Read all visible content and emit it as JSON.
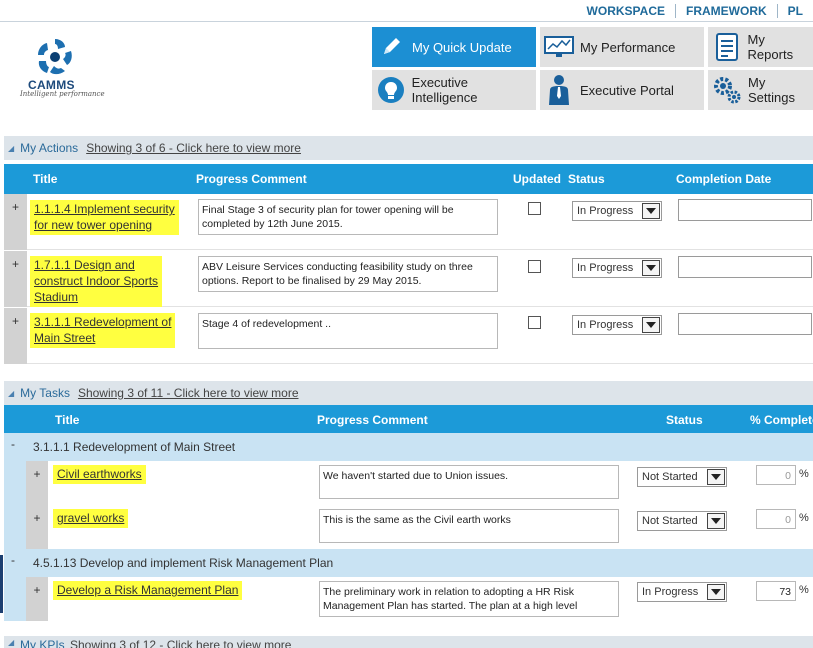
{
  "topnav": {
    "workspace": "WORKSPACE",
    "framework": "FRAMEWORK",
    "pl": "PL"
  },
  "logo": {
    "brand": "CAMMS",
    "tagline": "Intelligent performance"
  },
  "quick": {
    "update": "My Quick Update",
    "performance": "My Performance",
    "reports": "My Reports",
    "intelligence": "Executive Intelligence",
    "portal": "Executive Portal",
    "settings": "My Settings"
  },
  "actions": {
    "title": "My Actions",
    "more": "Showing 3 of 6 - Click here to view more",
    "headers": {
      "title": "Title",
      "comment": "Progress Comment",
      "updated": "Updated",
      "status": "Status",
      "date": "Completion Date"
    },
    "rows": [
      {
        "plus": "+",
        "title1": "1.1.1.4 Implement security",
        "title2": "for new tower opening",
        "title3": "",
        "comment1": "Final Stage 3 of security plan for tower opening will be",
        "comment2": "completed by 12th June 2015.",
        "status": "In Progress"
      },
      {
        "plus": "+",
        "title1": "1.7.1.1 Design and",
        "title2": "construct Indoor Sports",
        "title3": "Stadium",
        "comment1": "ABV Leisure Services conducting feasibility study on three",
        "comment2": "options. Report to be finalised by 29 May 2015.",
        "status": "In Progress"
      },
      {
        "plus": "+",
        "title1": "3.1.1.1 Redevelopment of",
        "title2": "Main Street",
        "title3": "",
        "comment1": "Stage 4 of redevelopment ..",
        "comment2": "",
        "status": "In Progress"
      }
    ]
  },
  "tasks": {
    "title": "My Tasks",
    "more": "Showing 3 of 11 - Click here to view more",
    "headers": {
      "title": "Title",
      "comment": "Progress Comment",
      "status": "Status",
      "complete": "% Complete"
    },
    "groups": [
      {
        "minus": "-",
        "label": "3.1.1.1 Redevelopment of Main Street"
      },
      {
        "minus": "-",
        "label": "4.5.1.13 Develop and implement Risk Management Plan"
      }
    ],
    "rows": [
      {
        "plus": "+",
        "title": "Civil earthworks",
        "comment1": "We haven't started due to Union issues.",
        "comment2": "",
        "status": "Not Started",
        "pct": "0",
        "pct_sign": "%"
      },
      {
        "plus": "+",
        "title": "gravel works",
        "comment1": "This is the same as the Civil earth works",
        "comment2": "",
        "status": "Not Started",
        "pct": "0",
        "pct_sign": "%"
      },
      {
        "plus": "+",
        "title": "Develop a Risk Management Plan",
        "comment1": "The preliminary work in relation to adopting a HR Risk",
        "comment2": "Management Plan has started. The plan at a high level",
        "status": "In Progress",
        "pct": "73",
        "pct_sign": "%"
      }
    ]
  },
  "kpis": {
    "title": "My KPIs",
    "more": "Showing 3 of 12 - Click here to view more"
  },
  "colors": {
    "accent": "#1c9ad8",
    "highlight": "#ffff40",
    "section": "#dde4ea",
    "group": "#c9e3f3"
  }
}
